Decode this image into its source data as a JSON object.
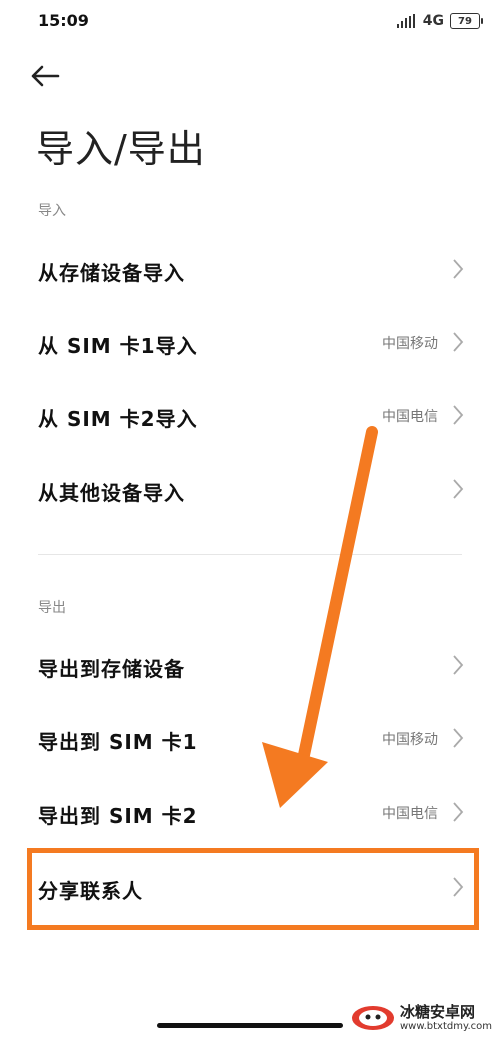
{
  "status_bar": {
    "time": "15:09",
    "network": "4G",
    "battery": "79"
  },
  "header": {
    "back_icon": "arrow-left-icon",
    "title": "导入/导出"
  },
  "import_section": {
    "header": "导入",
    "items": [
      {
        "label": "从存储设备导入",
        "value": ""
      },
      {
        "label": "从 SIM 卡1导入",
        "value": "中国移动"
      },
      {
        "label": "从 SIM 卡2导入",
        "value": "中国电信"
      },
      {
        "label": "从其他设备导入",
        "value": ""
      }
    ]
  },
  "export_section": {
    "header": "导出",
    "items": [
      {
        "label": "导出到存储设备",
        "value": ""
      },
      {
        "label": "导出到 SIM 卡1",
        "value": "中国移动"
      },
      {
        "label": "导出到 SIM 卡2",
        "value": "中国电信"
      },
      {
        "label": "分享联系人",
        "value": ""
      }
    ]
  },
  "annotation": {
    "color": "#f47a21",
    "highlighted_item": "分享联系人"
  },
  "watermark": {
    "name": "冰糖安卓网",
    "url": "www.btxtdmy.com"
  },
  "colors": {
    "background": "#ffffff",
    "text_primary": "#111111",
    "text_secondary": "#777777",
    "accent_annotation": "#f47a21"
  }
}
